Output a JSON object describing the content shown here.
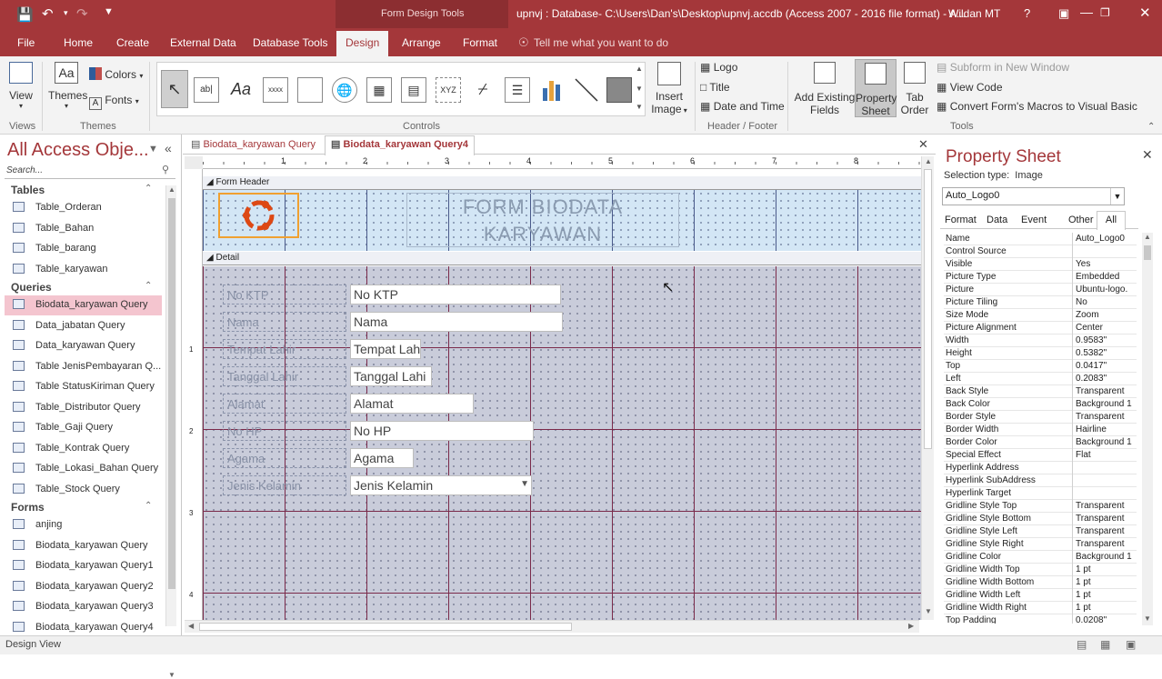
{
  "titlebar": {
    "context_tools": "Form Design Tools",
    "window_title": "upnvj : Database- C:\\Users\\Dan's\\Desktop\\upnvj.accdb (Access 2007 - 2016 file format) - A...",
    "user": "Wildan MT",
    "help": "?"
  },
  "tabs": [
    "File",
    "Home",
    "Create",
    "External Data",
    "Database Tools",
    "Design",
    "Arrange",
    "Format"
  ],
  "tell_me": "Tell me what you want to do",
  "ribbon": {
    "view": "View",
    "themes": "Themes",
    "colors": "Colors",
    "fonts": "Fonts",
    "group_views": "Views",
    "group_themes": "Themes",
    "group_controls": "Controls",
    "insert_image_1": "Insert",
    "insert_image_2": "Image",
    "logo": "Logo",
    "title": "Title",
    "date_time": "Date and Time",
    "group_header_footer": "Header / Footer",
    "add_existing_1": "Add Existing",
    "add_existing_2": "Fields",
    "property_sheet_1": "Property",
    "property_sheet_2": "Sheet",
    "tab_order_1": "Tab",
    "tab_order_2": "Order",
    "subform": "Subform in New Window",
    "view_code": "View Code",
    "convert_macros": "Convert Form's Macros to Visual Basic",
    "group_tools": "Tools",
    "ctl_ab": "ab|",
    "ctl_aa": "Aa",
    "ctl_xxxx": "xxxx",
    "ctl_xyz": "XYZ"
  },
  "nav": {
    "title": "All Access Obje...",
    "search": "Search...",
    "sections": [
      {
        "label": "Tables",
        "items": [
          "Table_Orderan",
          "Table_Bahan",
          "Table_barang",
          "Table_karyawan"
        ]
      },
      {
        "label": "Queries",
        "items": [
          "Biodata_karyawan Query",
          "Data_jabatan Query",
          "Data_karyawan Query",
          "Table JenisPembayaran Q...",
          "Table StatusKiriman Query",
          "Table_Distributor Query",
          "Table_Gaji Query",
          "Table_Kontrak Query",
          "Table_Lokasi_Bahan Query",
          "Table_Stock Query"
        ]
      },
      {
        "label": "Forms",
        "items": [
          "anjing",
          "Biodata_karyawan Query",
          "Biodata_karyawan Query1",
          "Biodata_karyawan Query2",
          "Biodata_karyawan Query3",
          "Biodata_karyawan Query4"
        ]
      }
    ]
  },
  "doc_tabs": [
    "Biodata_karyawan Query",
    "Biodata_karyawan Query4"
  ],
  "ruler_numbers": [
    "1",
    "2",
    "3",
    "4",
    "5",
    "6",
    "7",
    "8"
  ],
  "vruler_numbers": [
    "1",
    "2",
    "3",
    "4"
  ],
  "form": {
    "header_band": "Form Header",
    "detail_band": "Detail",
    "title_line1": "FORM BIODATA",
    "title_line2": "KARYAWAN",
    "fields": [
      {
        "label": "No KTP",
        "value": "No KTP"
      },
      {
        "label": "Nama",
        "value": "Nama"
      },
      {
        "label": "Tempat Lahir",
        "value": "Tempat Lah"
      },
      {
        "label": "Tanggal Lahir",
        "value": "Tanggal Lahi"
      },
      {
        "label": "Alamat",
        "value": "Alamat"
      },
      {
        "label": "No HP",
        "value": "No HP"
      },
      {
        "label": "Agama",
        "value": "Agama"
      },
      {
        "label": "Jenis Kelamin",
        "value": "Jenis Kelamin"
      }
    ]
  },
  "property_sheet": {
    "title": "Property Sheet",
    "selection_type": "Selection type:  Image",
    "selected": "Auto_Logo0",
    "tabs": [
      "Format",
      "Data",
      "Event",
      "Other",
      "All"
    ],
    "rows": [
      [
        "Name",
        "Auto_Logo0"
      ],
      [
        "Control Source",
        ""
      ],
      [
        "Visible",
        "Yes"
      ],
      [
        "Picture Type",
        "Embedded"
      ],
      [
        "Picture",
        "Ubuntu-logo."
      ],
      [
        "Picture Tiling",
        "No"
      ],
      [
        "Size Mode",
        "Zoom"
      ],
      [
        "Picture Alignment",
        "Center"
      ],
      [
        "Width",
        "0.9583\""
      ],
      [
        "Height",
        "0.5382\""
      ],
      [
        "Top",
        "0.0417\""
      ],
      [
        "Left",
        "0.2083\""
      ],
      [
        "Back Style",
        "Transparent"
      ],
      [
        "Back Color",
        "Background 1"
      ],
      [
        "Border Style",
        "Transparent"
      ],
      [
        "Border Width",
        "Hairline"
      ],
      [
        "Border Color",
        "Background 1"
      ],
      [
        "Special Effect",
        "Flat"
      ],
      [
        "Hyperlink Address",
        ""
      ],
      [
        "Hyperlink SubAddress",
        ""
      ],
      [
        "Hyperlink Target",
        ""
      ],
      [
        "Gridline Style Top",
        "Transparent"
      ],
      [
        "Gridline Style Bottom",
        "Transparent"
      ],
      [
        "Gridline Style Left",
        "Transparent"
      ],
      [
        "Gridline Style Right",
        "Transparent"
      ],
      [
        "Gridline Color",
        "Background 1"
      ],
      [
        "Gridline Width Top",
        "1 pt"
      ],
      [
        "Gridline Width Bottom",
        "1 pt"
      ],
      [
        "Gridline Width Left",
        "1 pt"
      ],
      [
        "Gridline Width Right",
        "1 pt"
      ],
      [
        "Top Padding",
        "0.0208\""
      ]
    ]
  },
  "status": "Design View",
  "colors": {
    "accent": "#a4373a",
    "detail_bg": "#c9ccda",
    "header_bg": "#d3e6f5",
    "grid_line": "#7a2a4a"
  }
}
